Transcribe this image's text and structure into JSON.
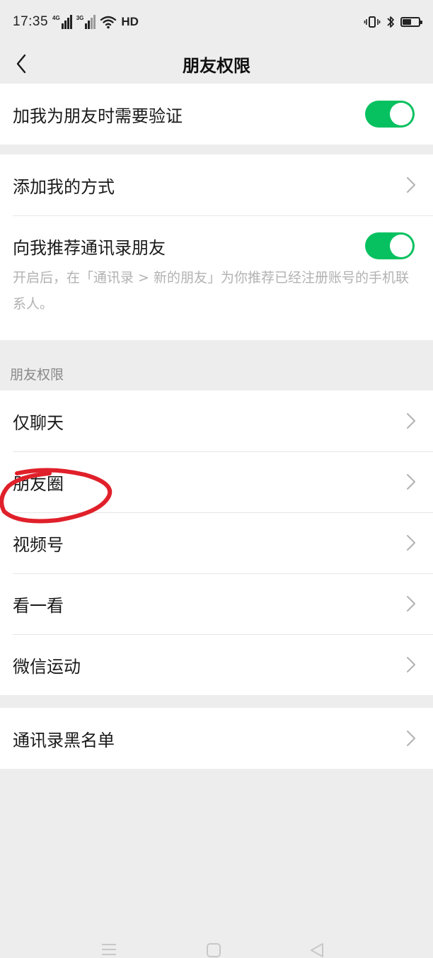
{
  "status_bar": {
    "time": "17:35",
    "network1": "4G",
    "network2": "3G",
    "hd": "HD"
  },
  "nav": {
    "title": "朋友权限",
    "back_icon": "chevron-left-icon"
  },
  "group1": {
    "verify_label": "加我为朋友时需要验证",
    "verify_on": true
  },
  "group2": {
    "add_methods_label": "添加我的方式",
    "recommend_label": "向我推荐通讯录朋友",
    "recommend_on": true,
    "recommend_desc": "开启后，在「通讯录 > 新的朋友」为你推荐已经注册账号的手机联系人。"
  },
  "section": {
    "title": "朋友权限"
  },
  "group3": {
    "items": [
      {
        "label": "仅聊天"
      },
      {
        "label": "朋友圈"
      },
      {
        "label": "视频号"
      },
      {
        "label": "看一看"
      },
      {
        "label": "微信运动"
      }
    ]
  },
  "group4": {
    "blacklist_label": "通讯录黑名单"
  },
  "colors": {
    "accent": "#07c160",
    "annotation": "#e0202a"
  }
}
